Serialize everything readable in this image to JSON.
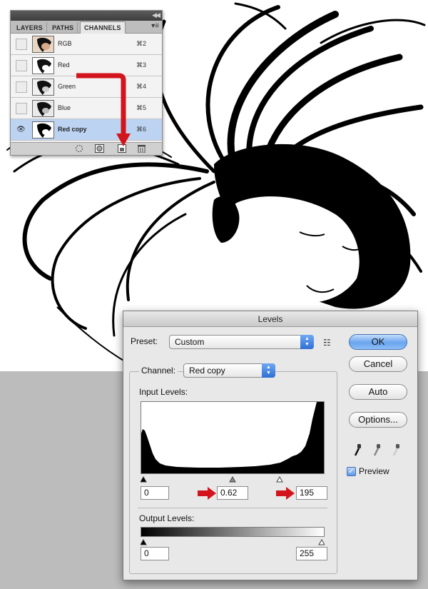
{
  "channels_panel": {
    "tabs": [
      "LAYERS",
      "PATHS",
      "CHANNELS"
    ],
    "active_tab": "CHANNELS",
    "channels": [
      {
        "name": "RGB",
        "shortcut": "⌘2",
        "visible": false,
        "selected": false
      },
      {
        "name": "Red",
        "shortcut": "⌘3",
        "visible": false,
        "selected": false
      },
      {
        "name": "Green",
        "shortcut": "⌘4",
        "visible": false,
        "selected": false
      },
      {
        "name": "Blue",
        "shortcut": "⌘5",
        "visible": false,
        "selected": false
      },
      {
        "name": "Red copy",
        "shortcut": "⌘6",
        "visible": true,
        "selected": true
      }
    ],
    "footer_icons": [
      "load-selection-icon",
      "save-selection-icon",
      "new-channel-icon",
      "trash-icon"
    ],
    "annotation": "drag Red channel onto new-channel-icon"
  },
  "levels": {
    "title": "Levels",
    "preset_label": "Preset:",
    "preset_value": "Custom",
    "channel_label": "Channel:",
    "channel_value": "Red copy",
    "input_levels_label": "Input Levels:",
    "input_black": "0",
    "input_gamma": "0.62",
    "input_white": "195",
    "output_levels_label": "Output Levels:",
    "output_black": "0",
    "output_white": "255",
    "buttons": {
      "ok": "OK",
      "cancel": "Cancel",
      "auto": "Auto",
      "options": "Options..."
    },
    "preview_label": "Preview",
    "preview_checked": true
  },
  "colors": {
    "accent_red": "#d4141c",
    "selection_blue": "#bcd3f2",
    "background_gray": "#bcbcbc"
  }
}
